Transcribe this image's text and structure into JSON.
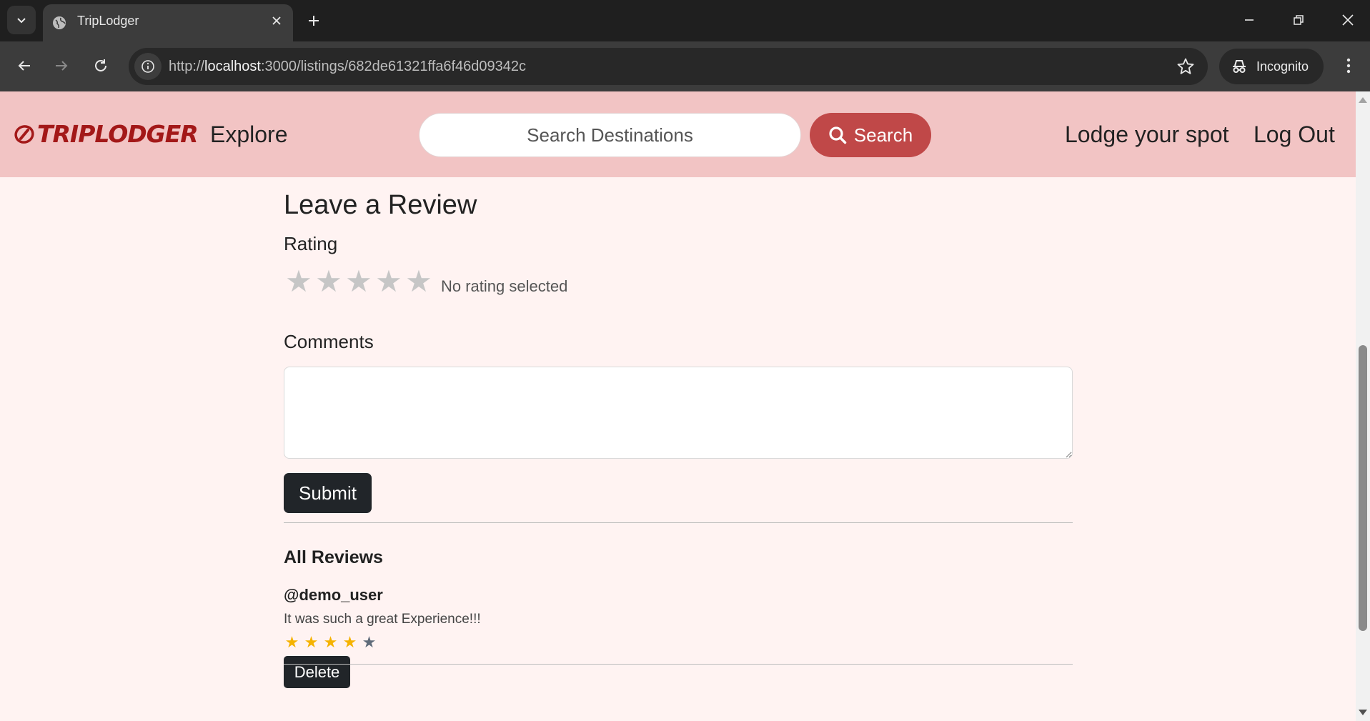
{
  "browser": {
    "tab_title": "TripLodger",
    "url_scheme": "http://",
    "url_host": "localhost",
    "url_rest": ":3000/listings/682de61321ffa6f46d09342c",
    "profile_label": "Incognito"
  },
  "navbar": {
    "brand": "TRIPLODGER",
    "explore": "Explore",
    "search_placeholder": "Search Destinations",
    "search_button": "Search",
    "lodge": "Lodge your spot",
    "logout": "Log Out",
    "brand_color": "#a31818",
    "background": "#f2c4c4",
    "search_button_color": "#c04848"
  },
  "review_form": {
    "heading": "Leave a Review",
    "rating_label": "Rating",
    "rating_value": 0,
    "rating_max": 5,
    "rating_status": "No rating selected",
    "comments_label": "Comments",
    "comments_value": "",
    "submit_label": "Submit"
  },
  "reviews": {
    "heading": "All Reviews",
    "items": [
      {
        "author": "@demo_user",
        "comment": "It was such a great Experience!!!",
        "rating": 4,
        "rating_max": 5,
        "delete_label": "Delete"
      }
    ]
  },
  "colors": {
    "page_bg": "#fff3f2",
    "star_filled": "#f5b301",
    "star_empty": "#5f6b7a",
    "button_dark": "#212529"
  }
}
